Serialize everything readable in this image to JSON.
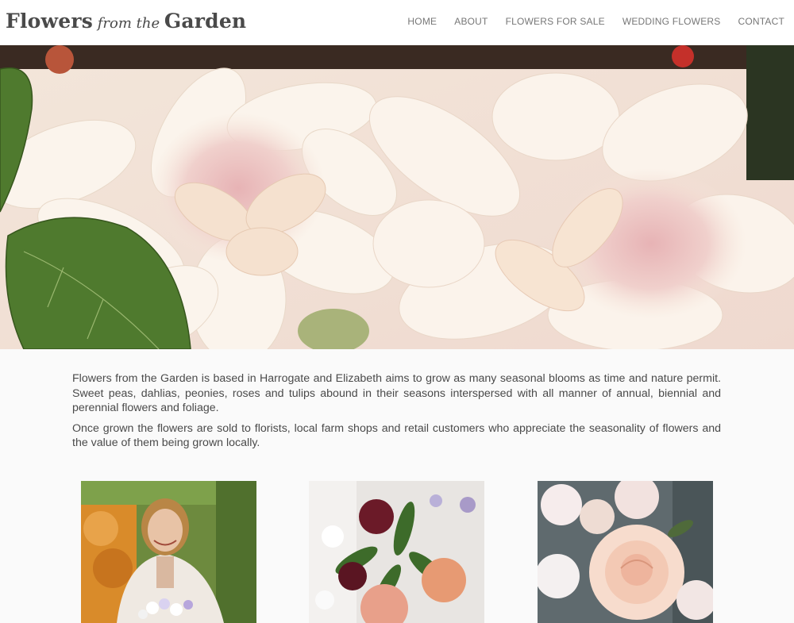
{
  "site": {
    "logo_part1": "Flowers",
    "logo_part2": " from the ",
    "logo_part3": "Garden"
  },
  "nav": {
    "items": [
      {
        "label": "HOME"
      },
      {
        "label": "ABOUT"
      },
      {
        "label": "FLOWERS FOR SALE"
      },
      {
        "label": "WEDDING FLOWERS"
      },
      {
        "label": "CONTACT"
      }
    ]
  },
  "hero": {
    "image": "hero-dahlias-photo",
    "colors": {
      "petal": "#f6ece1",
      "pink": "#ecc3c2",
      "leaf": "#4f7a2e"
    }
  },
  "intro": {
    "paragraph1": "Flowers from the Garden is based in Harrogate and Elizabeth aims to grow as many seasonal blooms as time and nature permit. Sweet peas, dahlias, peonies, roses and tulips abound in their seasons interspersed with all manner of annual, biennial and perennial flowers and foliage.",
    "paragraph2": "Once grown the flowers are sold to florists, local farm shops and retail customers who appreciate the seasonality of flowers and the value of them being grown locally."
  },
  "gallery": [
    {
      "image": "woman-with-bouquet-photo"
    },
    {
      "image": "mixed-bouquet-photo"
    },
    {
      "image": "roses-photo"
    }
  ]
}
